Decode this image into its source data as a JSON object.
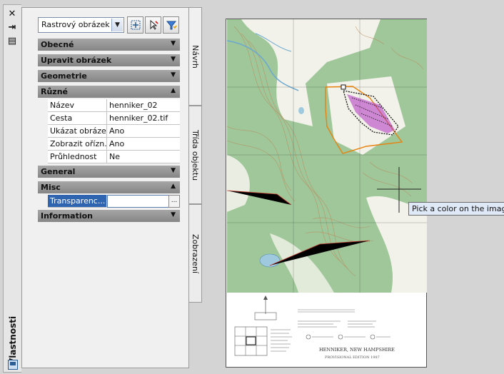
{
  "palette": {
    "title": "Vlastnosti",
    "object_type": "Rastrový obrázek",
    "tabs": [
      "Návrh",
      "Třída objektu",
      "Zobrazení"
    ],
    "sections": {
      "obecne": "Obecné",
      "upravit": "Upravit obrázek",
      "geometrie": "Geometrie",
      "ruzne": "Různé",
      "general": "General",
      "misc": "Misc",
      "information": "Information"
    },
    "props": [
      {
        "key": "Název",
        "value": "henniker_02"
      },
      {
        "key": "Cesta",
        "value": "henniker_02.tif"
      },
      {
        "key": "Ukázat obrázek",
        "value": "Ano"
      },
      {
        "key": "Zobrazit ořízn...",
        "value": "Ano"
      },
      {
        "key": "Průhlednost",
        "value": "Ne"
      }
    ],
    "misc_prop": {
      "key": "Transparenc...",
      "value": "",
      "button": "..."
    }
  },
  "drawing": {
    "tooltip": "Pick a color on the image:",
    "map_title_line1": "HENNIKER, NEW HAMPSHIRE",
    "map_title_line2": "PROVISIONAL EDITION 1987"
  },
  "colors": {
    "map_green": "#9fc79a",
    "map_white": "#f2f2ea",
    "contour": "#b98a5c",
    "water": "#9ec9df",
    "parcel_outline": "#e8820e",
    "parcel_fill": "#b030c0",
    "highlight": "#2f64b1"
  }
}
